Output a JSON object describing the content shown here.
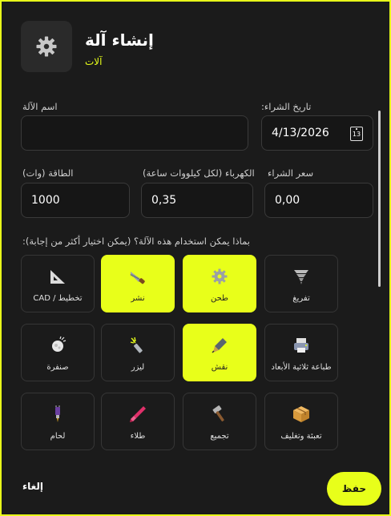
{
  "header": {
    "title": "إنشاء آلة",
    "subtitle": "آلات",
    "icon": "gear-icon"
  },
  "form": {
    "name_label": "اسم الآلة",
    "name_value": "",
    "purchase_date_label": ":تاريخ الشراء",
    "purchase_date_value": "4/13/2026",
    "calendar_day": "13",
    "power_label": "الطاقة (وات)",
    "power_value": "1000",
    "electricity_label": "الكهرباء (لكل كيلووات ساعة)",
    "electricity_value": "0,35",
    "price_label": "سعر الشراء",
    "price_value": "0,00"
  },
  "usage": {
    "question": ":بماذا يمكن استخدام هذه الآلة؟ (يمكن اختيار أكثر من إجابة)",
    "options": [
      {
        "label": "CAD / تخطيط",
        "icon": "set-square-icon",
        "selected": false
      },
      {
        "label": "نشر",
        "icon": "saw-icon",
        "selected": true
      },
      {
        "label": "طحن",
        "icon": "gear-icon",
        "selected": true
      },
      {
        "label": "تفريغ",
        "icon": "tornado-icon",
        "selected": false
      },
      {
        "label": "صنفرة",
        "icon": "sander-icon",
        "selected": false
      },
      {
        "label": "ليزر",
        "icon": "laser-icon",
        "selected": false
      },
      {
        "label": "نقش",
        "icon": "engraving-pen-icon",
        "selected": true
      },
      {
        "label": "طباعة ثلاثية الأبعاد",
        "icon": "printer-icon",
        "selected": false
      },
      {
        "label": "لحام",
        "icon": "soldering-iron-icon",
        "selected": false
      },
      {
        "label": "طلاء",
        "icon": "paintbrush-icon",
        "selected": false
      },
      {
        "label": "تجميع",
        "icon": "hammer-icon",
        "selected": false
      },
      {
        "label": "تعبئة وتغليف",
        "icon": "package-icon",
        "selected": false
      }
    ]
  },
  "footer": {
    "cancel_label": "إلغاء",
    "save_label": "حفظ"
  },
  "colors": {
    "accent": "#e8ff1a",
    "background": "#1b1b1b",
    "input_bg": "#161616"
  }
}
